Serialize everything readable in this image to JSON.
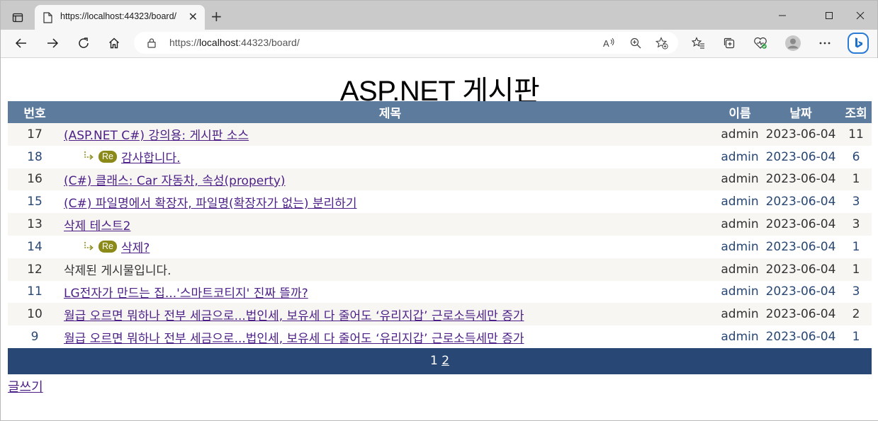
{
  "browser": {
    "tab_title": "https://localhost:44323/board/",
    "url_prefix": "https://",
    "url_host": "localhost",
    "url_rest": ":44323/board/"
  },
  "page": {
    "title": "ASP.NET 게시판",
    "write_label": "글쓰기"
  },
  "table": {
    "headers": {
      "num": "번호",
      "title": "제목",
      "name": "이름",
      "date": "날짜",
      "views": "조회"
    },
    "rows": [
      {
        "num": "17",
        "title": "(ASP.NET C#) 강의용: 게시판 소스",
        "reply": false,
        "link": true,
        "name": "admin",
        "date": "2023-06-04",
        "views": "11"
      },
      {
        "num": "18",
        "title": "감사합니다.",
        "reply": true,
        "link": true,
        "name": "admin",
        "date": "2023-06-04",
        "views": "6"
      },
      {
        "num": "16",
        "title": "(C#) 클래스: Car 자동차, 속성(property)",
        "reply": false,
        "link": true,
        "name": "admin",
        "date": "2023-06-04",
        "views": "1"
      },
      {
        "num": "15",
        "title": "(C#) 파일명에서 확장자, 파일명(확장자가 없는) 분리하기",
        "reply": false,
        "link": true,
        "name": "admin",
        "date": "2023-06-04",
        "views": "3"
      },
      {
        "num": "13",
        "title": "삭제 테스트2",
        "reply": false,
        "link": true,
        "name": "admin",
        "date": "2023-06-04",
        "views": "3"
      },
      {
        "num": "14",
        "title": "삭제?",
        "reply": true,
        "link": true,
        "name": "admin",
        "date": "2023-06-04",
        "views": "1"
      },
      {
        "num": "12",
        "title": "삭제된 게시물입니다.",
        "reply": false,
        "link": false,
        "name": "admin",
        "date": "2023-06-04",
        "views": "1"
      },
      {
        "num": "11",
        "title": "LG전자가 만드는 집...'스마트코티지' 진짜 뜰까?",
        "reply": false,
        "link": true,
        "name": "admin",
        "date": "2023-06-04",
        "views": "3"
      },
      {
        "num": "10",
        "title": "월급 오르면 뭐하나 전부 세금으로...법인세, 보유세 다 줄어도 ‘유리지갑’ 근로소득세만 증가",
        "reply": false,
        "link": true,
        "name": "admin",
        "date": "2023-06-04",
        "views": "2"
      },
      {
        "num": "9",
        "title": "월급 오르면 뭐하나 전부 세금으로...법인세, 보유세 다 줄어도 ‘유리지갑’ 근로소득세만 증가",
        "reply": false,
        "link": true,
        "name": "admin",
        "date": "2023-06-04",
        "views": "1"
      }
    ],
    "reply_badge": "Re"
  },
  "pager": {
    "current": "1",
    "other": "2"
  },
  "colors": {
    "header_bg": "#5d7b9d",
    "pager_bg": "#284775",
    "alt_row_bg": "#f7f6f3",
    "link": "#4b1f86",
    "reply_badge": "#8b8a18"
  }
}
